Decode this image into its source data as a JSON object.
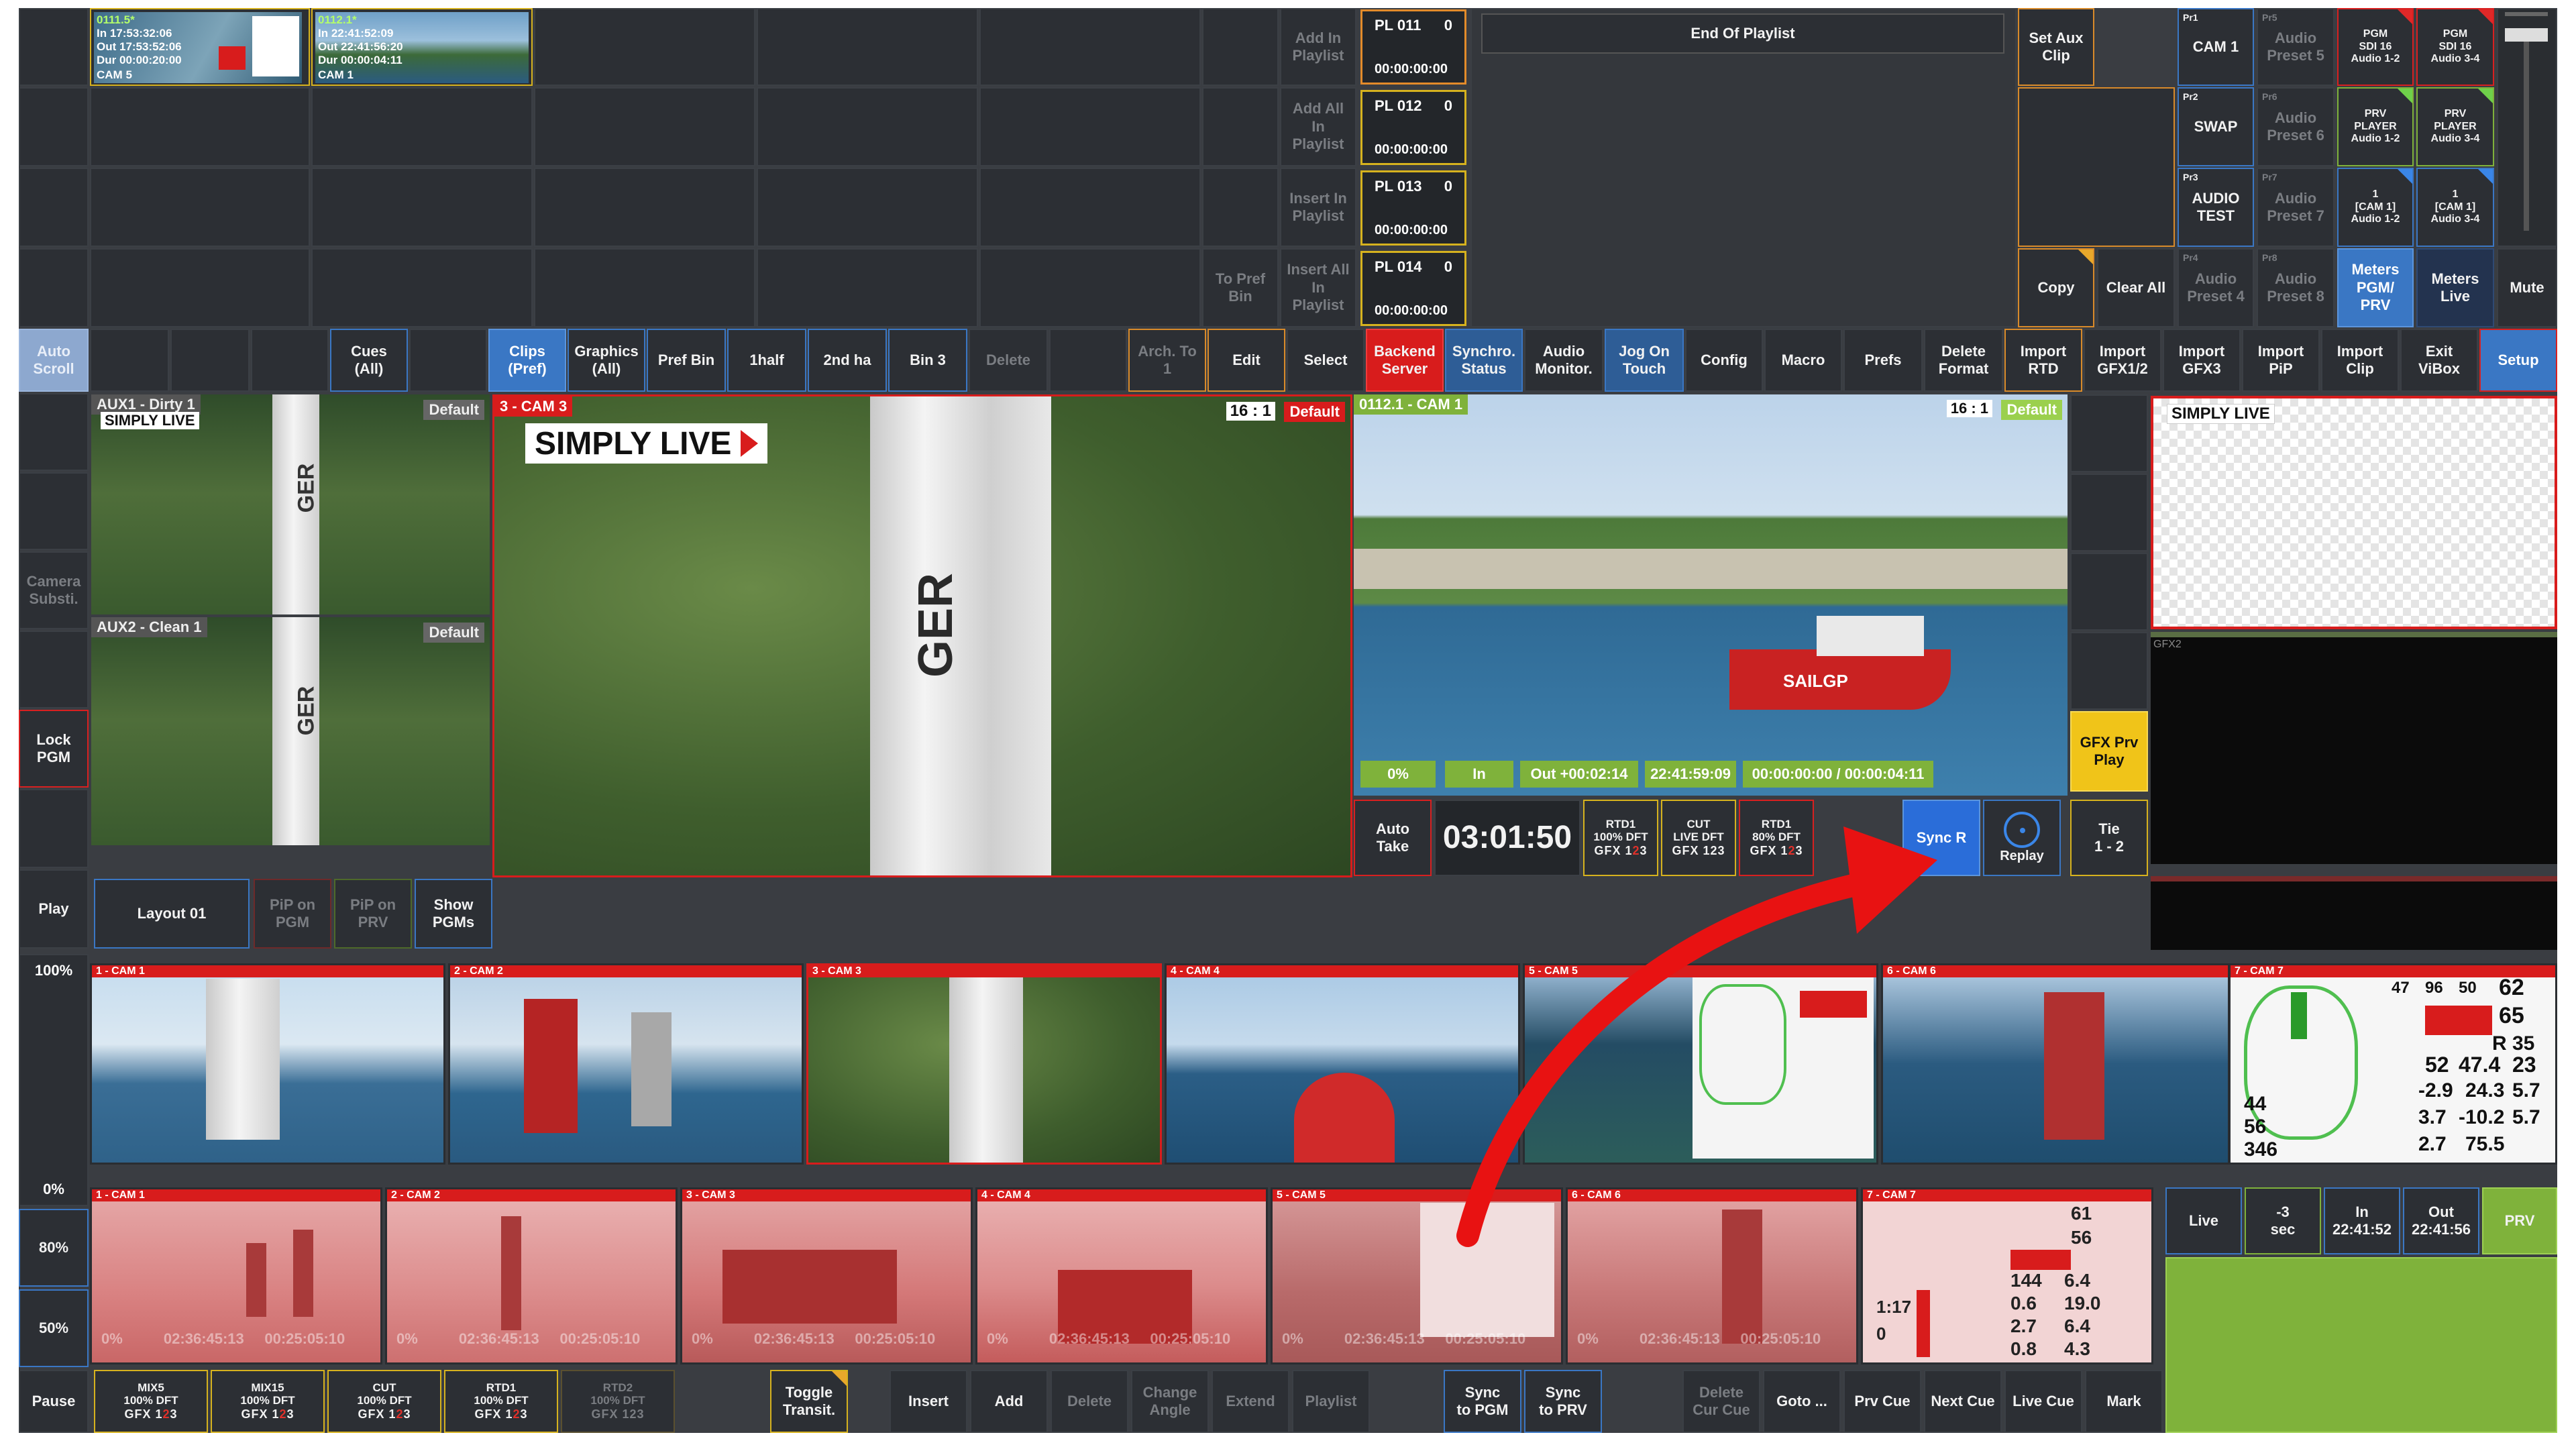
{
  "colors": {
    "accent_blue": "#3a77c4",
    "alert_red": "#d81c1c",
    "preview_green": "#7fb23b",
    "tally_yellow": "#f0c419"
  },
  "top_clips": [
    {
      "name": "0111.5*",
      "in": "In   17:53:32:06",
      "out": "Out  17:53:52:06",
      "dur": "Dur  00:00:20:00",
      "cam": "CAM 5"
    },
    {
      "name": "0112.1*",
      "in": "In   22:41:52:09",
      "out": "Out  22:41:56:20",
      "dur": "Dur  00:00:04:11",
      "cam": "CAM 1"
    }
  ],
  "bin_actions": [
    "Add In\nPlaylist",
    "Add All\nIn\nPlaylist",
    "Insert In\nPlaylist",
    "Insert All\nIn\nPlaylist"
  ],
  "to_pref_bin": "To Pref\nBin",
  "playlist": [
    {
      "name": "PL 011",
      "count": "0",
      "dur": "00:00:00:00"
    },
    {
      "name": "PL 012",
      "count": "0",
      "dur": "00:00:00:00"
    },
    {
      "name": "PL 013",
      "count": "0",
      "dur": "00:00:00:00"
    },
    {
      "name": "PL 014",
      "count": "0",
      "dur": "00:00:00:00"
    }
  ],
  "end_of_playlist": "End Of Playlist",
  "set_aux_clip": "Set Aux\nClip",
  "copy": "Copy",
  "clear_all": "Clear All",
  "presets": [
    {
      "tag": "Pr1",
      "label": "CAM 1"
    },
    {
      "tag": "Pr5",
      "label": "Audio\nPreset 5"
    },
    {
      "tag": "Pr2",
      "label": "SWAP"
    },
    {
      "tag": "Pr6",
      "label": "Audio\nPreset 6"
    },
    {
      "tag": "Pr3",
      "label": "AUDIO\nTEST"
    },
    {
      "tag": "Pr7",
      "label": "Audio\nPreset 7"
    },
    {
      "tag": "Pr4",
      "label": "Audio\nPreset 4"
    },
    {
      "tag": "Pr8",
      "label": "Audio\nPreset 8"
    }
  ],
  "audio_routes": [
    "PGM\nSDI 16\nAudio 1-2",
    "PGM\nSDI 16\nAudio 3-4",
    "PRV\nPLAYER\nAudio 1-2",
    "PRV\nPLAYER\nAudio 3-4",
    "1\n[CAM 1]\nAudio 1-2",
    "1\n[CAM 1]\nAudio 3-4"
  ],
  "meters_pgm": "Meters\nPGM/\nPRV",
  "meters_live": "Meters\nLive",
  "mute": "Mute",
  "toolbar": {
    "auto_scroll": "Auto\nScroll",
    "cues": "Cues\n(All)",
    "clips_pref": "Clips\n(Pref)",
    "graphics_all": "Graphics\n(All)",
    "pref_bin": "Pref Bin",
    "half": "1half",
    "second_ha": "2nd ha",
    "bin3": "Bin 3",
    "delete": "Delete",
    "arch": "Arch. To\n1",
    "edit": "Edit",
    "select": "Select",
    "backend": "Backend\nServer",
    "synchro": "Synchro.\nStatus",
    "audio_monitor": "Audio\nMonitor.",
    "jog": "Jog On\nTouch",
    "config": "Config",
    "macro": "Macro",
    "prefs": "Prefs",
    "delete_format": "Delete\nFormat",
    "import_rtd": "Import\nRTD",
    "import_gfx12": "Import\nGFX1/2",
    "import_gfx3": "Import\nGFX3",
    "import_pip": "Import\nPiP",
    "import_clip": "Import\nClip",
    "exit_vibox": "Exit\nViBox",
    "setup": "Setup"
  },
  "side": {
    "camera_subst": "Camera\nSubsti.",
    "lock_pgm": "Lock\nPGM",
    "play": "Play",
    "pct100": "100%",
    "pct0": "0%",
    "pct80": "80%",
    "pct50": "50%",
    "pause": "Pause"
  },
  "monitors": {
    "aux1": "AUX1 - Dirty 1",
    "aux2": "AUX2 - Clean 1",
    "default": "Default",
    "pgm_label": "3 - CAM 3",
    "ratio": "16 : 1",
    "logo": "SIMPLY LIVE",
    "logo_small": "SIMPLY LIVE",
    "prv_label": "0112.1 - CAM 1",
    "ratio_prv": "16 : 1",
    "boat_text": "SAILGP",
    "sail_text": "GER",
    "gfx2": "GFX2"
  },
  "prv_status": {
    "speed": "0%",
    "in": "In",
    "out": "Out +00:02:14",
    "tc": "22:41:59:09",
    "dur": "00:00:00:00 / 00:00:04:11"
  },
  "transport": {
    "auto_take": "Auto\nTake",
    "clock": "03:01:50",
    "sync_r": "Sync R",
    "replay": "Replay",
    "tie": "Tie\n1 - 2",
    "gfx_prv_play": "GFX Prv\nPlay"
  },
  "trans_buttons": [
    {
      "top": "RTD1",
      "mid": "100% DFT",
      "g": "GFX",
      "n1": "1",
      "n2": "2",
      "n3": "3"
    },
    {
      "top": "CUT",
      "mid": "LIVE DFT",
      "g": "GFX",
      "n1": "1",
      "n2": "2",
      "n3": "3"
    },
    {
      "top": "RTD1",
      "mid": "80% DFT",
      "g": "GFX",
      "n1": "1",
      "n2": "2",
      "n3": "3"
    }
  ],
  "layout": {
    "layout01": "Layout 01",
    "pip_pgm": "PiP on\nPGM",
    "pip_prv": "PiP on\nPRV",
    "show_pgms": "Show\nPGMs"
  },
  "cams_top": [
    "1 - CAM 1",
    "2 - CAM 2",
    "3 - CAM 3",
    "4 - CAM 4",
    "5 - CAM 5",
    "6 - CAM 6",
    "7 - CAM 7"
  ],
  "cams_bottom": [
    "1 - CAM 1",
    "2 - CAM 2",
    "3 - CAM 3",
    "4 - CAM 4",
    "5 - CAM 5",
    "6 - CAM 6",
    "7 - CAM 7"
  ],
  "cam_timecode": "0%          02:36:45:13     00:25:05:10",
  "telemetry": {
    "a": "62",
    "b": "65",
    "c": "R 35",
    "d": "52",
    "e": "47.4",
    "f": "23",
    "g": "-2.9",
    "h": "24.3",
    "i": "5.7",
    "j": "3.7",
    "k": "-10.2",
    "l": "2.7",
    "m": "75.5",
    "n": "44",
    "o": "56",
    "p": "346",
    "q": "47",
    "r": "96",
    "s": "50",
    "u": "61",
    "v": "56",
    "w": "144",
    "x": "6.4",
    "y": "0.6",
    "z": "19.0",
    "aa": "0.8",
    "ab": "1:17",
    "ac": "0",
    "ad": "6.4",
    "ae": "4.3",
    "af": "2.7"
  },
  "right_bottom": {
    "live": "Live",
    "minus3": "-3\nsec",
    "in": "In\n22:41:52",
    "out": "Out\n22:41:56",
    "prv": "PRV"
  },
  "bottom_bar": [
    {
      "top": "MIX5",
      "mid": "100% DFT"
    },
    {
      "top": "MIX15",
      "mid": "100% DFT"
    },
    {
      "top": "CUT",
      "mid": "100% DFT"
    },
    {
      "top": "RTD1",
      "mid": "100% DFT"
    },
    {
      "top": "RTD2",
      "mid": "100% DFT"
    }
  ],
  "bottom_actions": {
    "toggle": "Toggle\nTransit.",
    "insert": "Insert",
    "add": "Add",
    "delete": "Delete",
    "change_angle": "Change\nAngle",
    "extend": "Extend",
    "playlist": "Playlist",
    "sync_pgm": "Sync\nto PGM",
    "sync_prv": "Sync\nto PRV",
    "delete_cue": "Delete\nCur Cue",
    "goto": "Goto ...",
    "prv_cue": "Prv Cue",
    "next_cue": "Next Cue",
    "live_cue": "Live Cue",
    "mark": "Mark"
  }
}
